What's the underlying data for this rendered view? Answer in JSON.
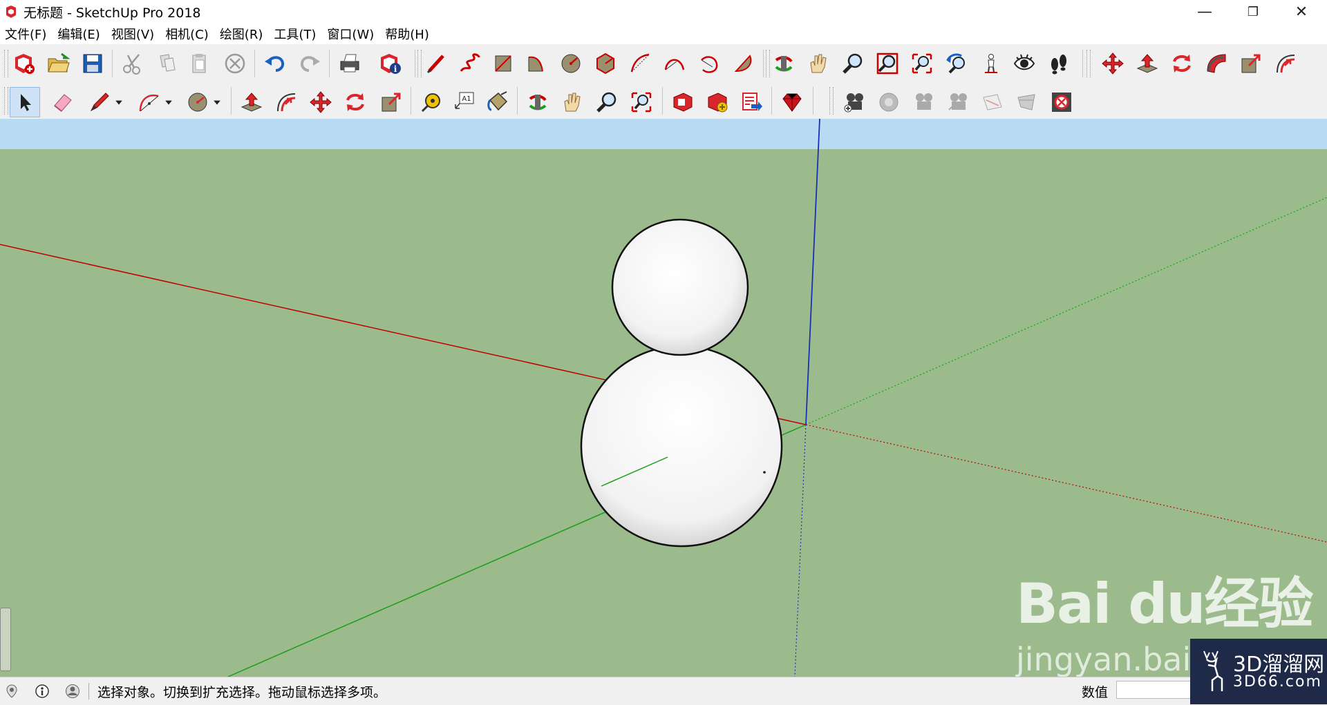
{
  "window": {
    "title": "无标题 - SketchUp Pro 2018",
    "controls": {
      "minimize": "—",
      "restore": "❐",
      "close": "✕"
    }
  },
  "menu": [
    "文件(F)",
    "编辑(E)",
    "视图(V)",
    "相机(C)",
    "绘图(R)",
    "工具(T)",
    "窗口(W)",
    "帮助(H)"
  ],
  "toolbar_icons_row1": [
    "new-icon",
    "open-icon",
    "save-icon",
    "cut-icon",
    "copy-icon",
    "paste-icon",
    "erase-icon",
    "undo-icon",
    "redo-icon",
    "print-icon",
    "model-info-icon",
    "line-icon",
    "freehand-icon",
    "rectangle-icon",
    "rotated-rectangle-icon",
    "circle-icon",
    "polygon-icon",
    "arc-icon",
    "two-point-arc-icon",
    "three-point-arc-icon",
    "pie-icon",
    "orbit-icon",
    "pan-icon",
    "zoom-icon",
    "zoom-window-icon",
    "zoom-extents-icon",
    "previous-view-icon",
    "position-camera-icon",
    "look-around-icon",
    "walk-icon",
    "move-icon",
    "push-pull-icon",
    "rotate-icon",
    "follow-me-icon",
    "scale-icon",
    "offset-icon"
  ],
  "toolbar_icons_row2": [
    "select-icon",
    "eraser-icon",
    "pencil-icon",
    "arc-tool-icon",
    "circle-tool-icon",
    "push-pull-icon",
    "follow-me-icon",
    "move-icon",
    "rotate-icon",
    "scale-icon",
    "tape-measure-icon",
    "text-icon",
    "paint-bucket-icon",
    "orbit-icon",
    "pan-icon",
    "zoom-icon",
    "zoom-extents-icon",
    "3d-warehouse-icon",
    "extension-warehouse-icon",
    "layout-send-icon",
    "ruby-icon",
    "add-scene-icon",
    "photo-match-icon",
    "camera-icon",
    "camera-icon-2",
    "section-plane-icon",
    "section-cut-icon",
    "section-close-icon"
  ],
  "status": {
    "text": "选择对象。切换到扩充选择。拖动鼠标选择多项。",
    "vcb_label": "数值"
  },
  "watermark": {
    "baidu": "Bai du经验",
    "url": "jingyan.baidu"
  },
  "logo": {
    "line1": "3D溜溜网",
    "line2": "3D66.com"
  },
  "colors": {
    "sky": "#b9daf3",
    "ground": "#9bbb8c",
    "red_axis": "#c00000",
    "green_axis": "#1a9e1a",
    "blue_axis": "#1a2fb8"
  }
}
